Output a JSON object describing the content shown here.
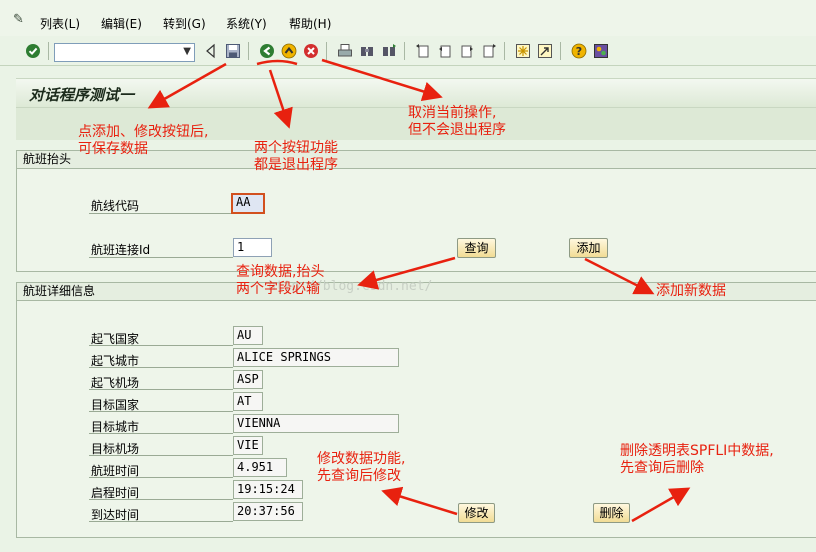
{
  "menu": {
    "items": [
      "列表(L)",
      "编辑(E)",
      "转到(G)",
      "系统(Y)",
      "帮助(H)"
    ]
  },
  "toolbar": {
    "command_field_value": "",
    "icons": [
      "enter-icon",
      "command-dropdown-icon",
      "save-icon",
      "back-icon",
      "exit-icon",
      "cancel-icon",
      "print-icon",
      "find-icon",
      "find-next-icon",
      "first-page-icon",
      "previous-page-icon",
      "next-page-icon",
      "last-page-icon",
      "new-session-icon",
      "shortcut-icon",
      "help-icon",
      "layout-icon"
    ]
  },
  "screen": {
    "title": "对话程序测试一"
  },
  "header_group": {
    "title": "航班抬头",
    "carrier_label": "航线代码",
    "carrier_value": "AA",
    "connid_label": "航班连接Id",
    "connid_value": "1",
    "query_button": "查询",
    "add_button": "添加"
  },
  "detail_group": {
    "title": "航班详细信息",
    "fields": [
      {
        "label": "起飞国家",
        "value": "AU"
      },
      {
        "label": "起飞城市",
        "value": "ALICE SPRINGS"
      },
      {
        "label": "起飞机场",
        "value": "ASP"
      },
      {
        "label": "目标国家",
        "value": "AT"
      },
      {
        "label": "目标城市",
        "value": "VIENNA"
      },
      {
        "label": "目标机场",
        "value": "VIE"
      },
      {
        "label": "航班时间",
        "value": "4.951"
      },
      {
        "label": "启程时间",
        "value": "19:15:24"
      },
      {
        "label": "到达时间",
        "value": "20:37:56"
      }
    ],
    "modify_button": "修改",
    "delete_button": "删除"
  },
  "annotations": {
    "save_note": [
      "点添加、修改按钮后,",
      "可保存数据"
    ],
    "exit_note": [
      "两个按钮功能",
      "都是退出程序"
    ],
    "cancel_note": [
      "取消当前操作,",
      "但不会退出程序"
    ],
    "query_note": [
      "查询数据,抬头",
      "两个字段必输"
    ],
    "add_note": "添加新数据",
    "modify_note": [
      "修改数据功能,",
      "先查询后修改"
    ],
    "delete_note": [
      "删除透明表SPFLI中数据,",
      "先查询后删除"
    ]
  },
  "watermark": "http://blog.csdn.net/",
  "colors": {
    "annotation": "#e8210f",
    "background": "#eaf3e6",
    "button": "#f1dc95",
    "focus_border": "#d2501e"
  }
}
